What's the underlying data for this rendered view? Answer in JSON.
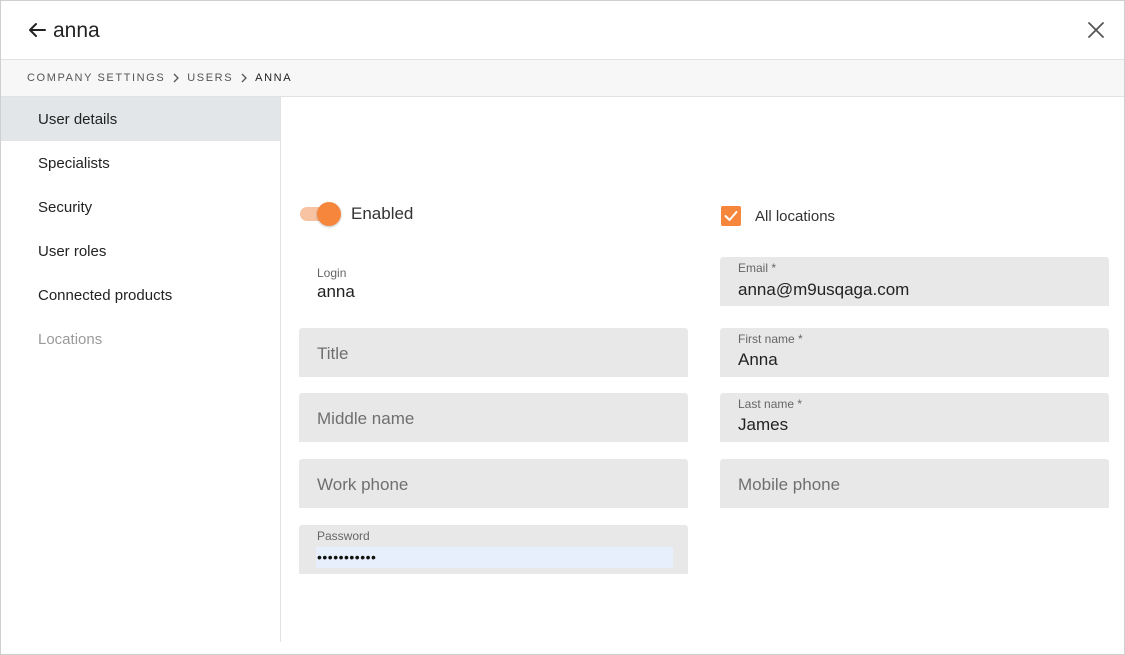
{
  "header": {
    "title": "anna"
  },
  "breadcrumb": [
    "COMPANY SETTINGS",
    "USERS",
    "ANNA"
  ],
  "sidebar": {
    "items": [
      {
        "label": "User details"
      },
      {
        "label": "Specialists"
      },
      {
        "label": "Security"
      },
      {
        "label": "User roles"
      },
      {
        "label": "Connected products"
      },
      {
        "label": "Locations"
      }
    ]
  },
  "form": {
    "enabled": {
      "label": "Enabled",
      "on": true
    },
    "all_locations": {
      "label": "All locations",
      "checked": true
    },
    "login": {
      "label": "Login",
      "value": "anna"
    },
    "email": {
      "label": "Email *",
      "value": "anna@m9usqaga.com"
    },
    "title": {
      "placeholder": "Title"
    },
    "first_name": {
      "label": "First name *",
      "value": "Anna"
    },
    "middle_name": {
      "placeholder": "Middle name"
    },
    "last_name": {
      "label": "Last name *",
      "value": "James"
    },
    "work_phone": {
      "placeholder": "Work phone"
    },
    "mobile_phone": {
      "placeholder": "Mobile phone"
    },
    "password": {
      "label": "Password",
      "value": "•••••••••••"
    }
  },
  "colors": {
    "accent": "#f5863c",
    "accent_light": "#f7c3a3",
    "field_bg": "#e8e8e8",
    "active_nav": "#e3e6e8"
  }
}
